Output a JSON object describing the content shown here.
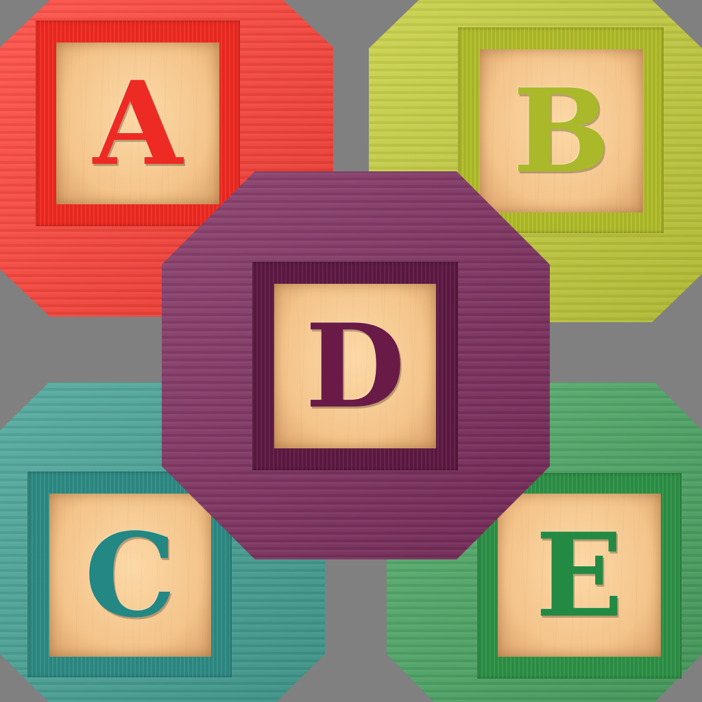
{
  "blocks": [
    {
      "id": "a",
      "letter": "A",
      "color": "#fe3f35",
      "frame": "#f22a22",
      "letter_color": "#ee2a24"
    },
    {
      "id": "b",
      "letter": "B",
      "color": "#c4cd3a",
      "frame": "#b3bf2a",
      "letter_color": "#a9b92a"
    },
    {
      "id": "c",
      "letter": "C",
      "color": "#43a194",
      "frame": "#2e8d86",
      "letter_color": "#238784"
    },
    {
      "id": "d",
      "letter": "D",
      "color": "#7c2c5d",
      "frame": "#5f1a44",
      "letter_color": "#6a1a47"
    },
    {
      "id": "e",
      "letter": "E",
      "color": "#49a562",
      "frame": "#2e9347",
      "letter_color": "#228a43"
    }
  ]
}
